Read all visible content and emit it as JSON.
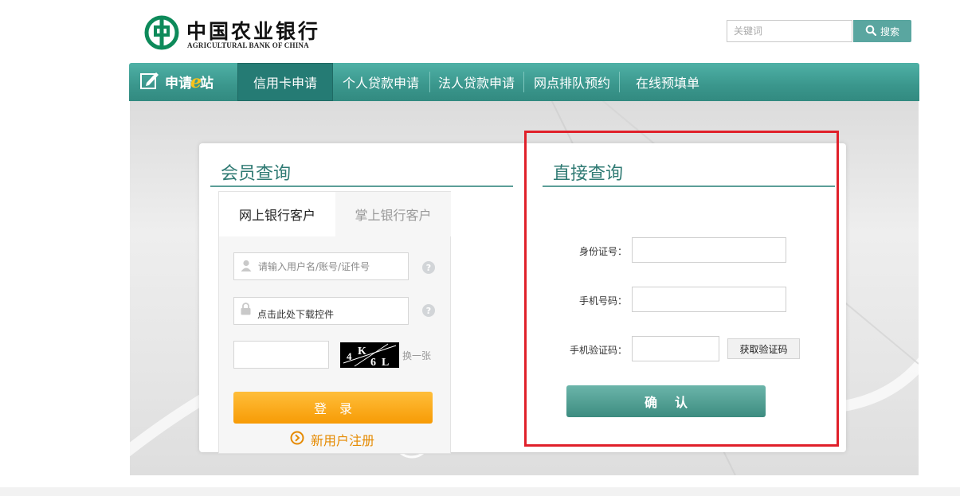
{
  "header": {
    "logo_cn": "中国农业银行",
    "logo_en": "AGRICULTURAL BANK OF CHINA",
    "search_placeholder": "关键词",
    "search_button": "搜索"
  },
  "nav": {
    "brand_pre": "申请",
    "brand_e": "e",
    "brand_post": "站",
    "items": [
      "信用卡申请",
      "个人贷款申请",
      "法人贷款申请",
      "网点排队预约",
      "在线预填单"
    ],
    "active_index": 0
  },
  "member": {
    "title": "会员查询",
    "tabs": [
      "网上银行客户",
      "掌上银行客户"
    ],
    "username_placeholder": "请输入用户名/账号/证件号",
    "password_text": "点击此处下载控件",
    "help_glyph": "?",
    "captcha_chars": [
      "4",
      "K",
      "6",
      "L"
    ],
    "refresh_text": "换一张",
    "login_button": "登录",
    "register_link": "新用户注册"
  },
  "direct": {
    "title": "直接查询",
    "id_label": "身份证号：",
    "phone_label": "手机号码：",
    "code_label": "手机验证码：",
    "get_code_button": "获取验证码",
    "confirm_button": "确认"
  },
  "colors": {
    "brand_teal": "#3a968c",
    "brand_title": "#2f7a73",
    "login_orange": "#f79b05",
    "highlight_red": "#e0202a"
  }
}
